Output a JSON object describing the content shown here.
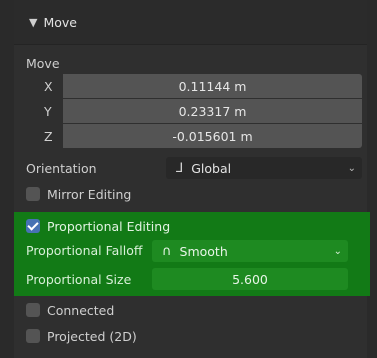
{
  "panel": {
    "title": "Move",
    "section_label": "Move"
  },
  "move": {
    "x": {
      "label": "X",
      "value": "0.11144 m"
    },
    "y": {
      "label": "Y",
      "value": "0.23317 m"
    },
    "z": {
      "label": "Z",
      "value": "-0.015601 m"
    }
  },
  "orientation": {
    "label": "Orientation",
    "value": "Global"
  },
  "mirror_editing": {
    "label": "Mirror Editing",
    "checked": false
  },
  "proportional_editing": {
    "label": "Proportional Editing",
    "checked": true
  },
  "proportional_falloff": {
    "label": "Proportional Falloff",
    "value": "Smooth"
  },
  "proportional_size": {
    "label": "Proportional Size",
    "value": "5.600"
  },
  "connected": {
    "label": "Connected",
    "checked": false
  },
  "projected": {
    "label": "Projected (2D)",
    "checked": false
  },
  "colors": {
    "panel_bg": "#2f2f2f",
    "field_bg": "#545454",
    "highlight_green": "#127a16",
    "checkbox_checked": "#4772b3"
  }
}
